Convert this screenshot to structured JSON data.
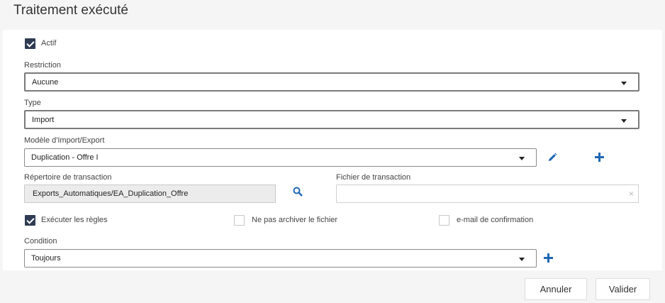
{
  "dialog": {
    "title": "Traitement exécuté"
  },
  "actif": {
    "label": "Actif",
    "checked": true
  },
  "restriction": {
    "label": "Restriction",
    "value": "Aucune"
  },
  "type": {
    "label": "Type",
    "value": "Import"
  },
  "modele": {
    "label": "Modèle d'Import/Export",
    "value": "Duplication - Offre I",
    "edit_icon": "pencil-icon",
    "add_icon": "plus-icon"
  },
  "repertoire": {
    "label": "Répertoire de transaction",
    "value": "Exports_Automatiques/EA_Duplication_Offre",
    "search_icon": "search-icon"
  },
  "fichier": {
    "label": "Fichier de transaction",
    "value": "",
    "clear_symbol": "×"
  },
  "options": {
    "executer": {
      "label": "Exécuter les règles",
      "checked": true
    },
    "archiver": {
      "label": "Ne pas archiver le fichier",
      "checked": false
    },
    "email": {
      "label": "e-mail de confirmation",
      "checked": false
    }
  },
  "condition": {
    "label": "Condition",
    "value": "Toujours",
    "add_icon": "plus-icon"
  },
  "footer": {
    "cancel": "Annuler",
    "validate": "Valider"
  },
  "colors": {
    "accent": "#1f67b4",
    "checkbox": "#2f3b52"
  }
}
